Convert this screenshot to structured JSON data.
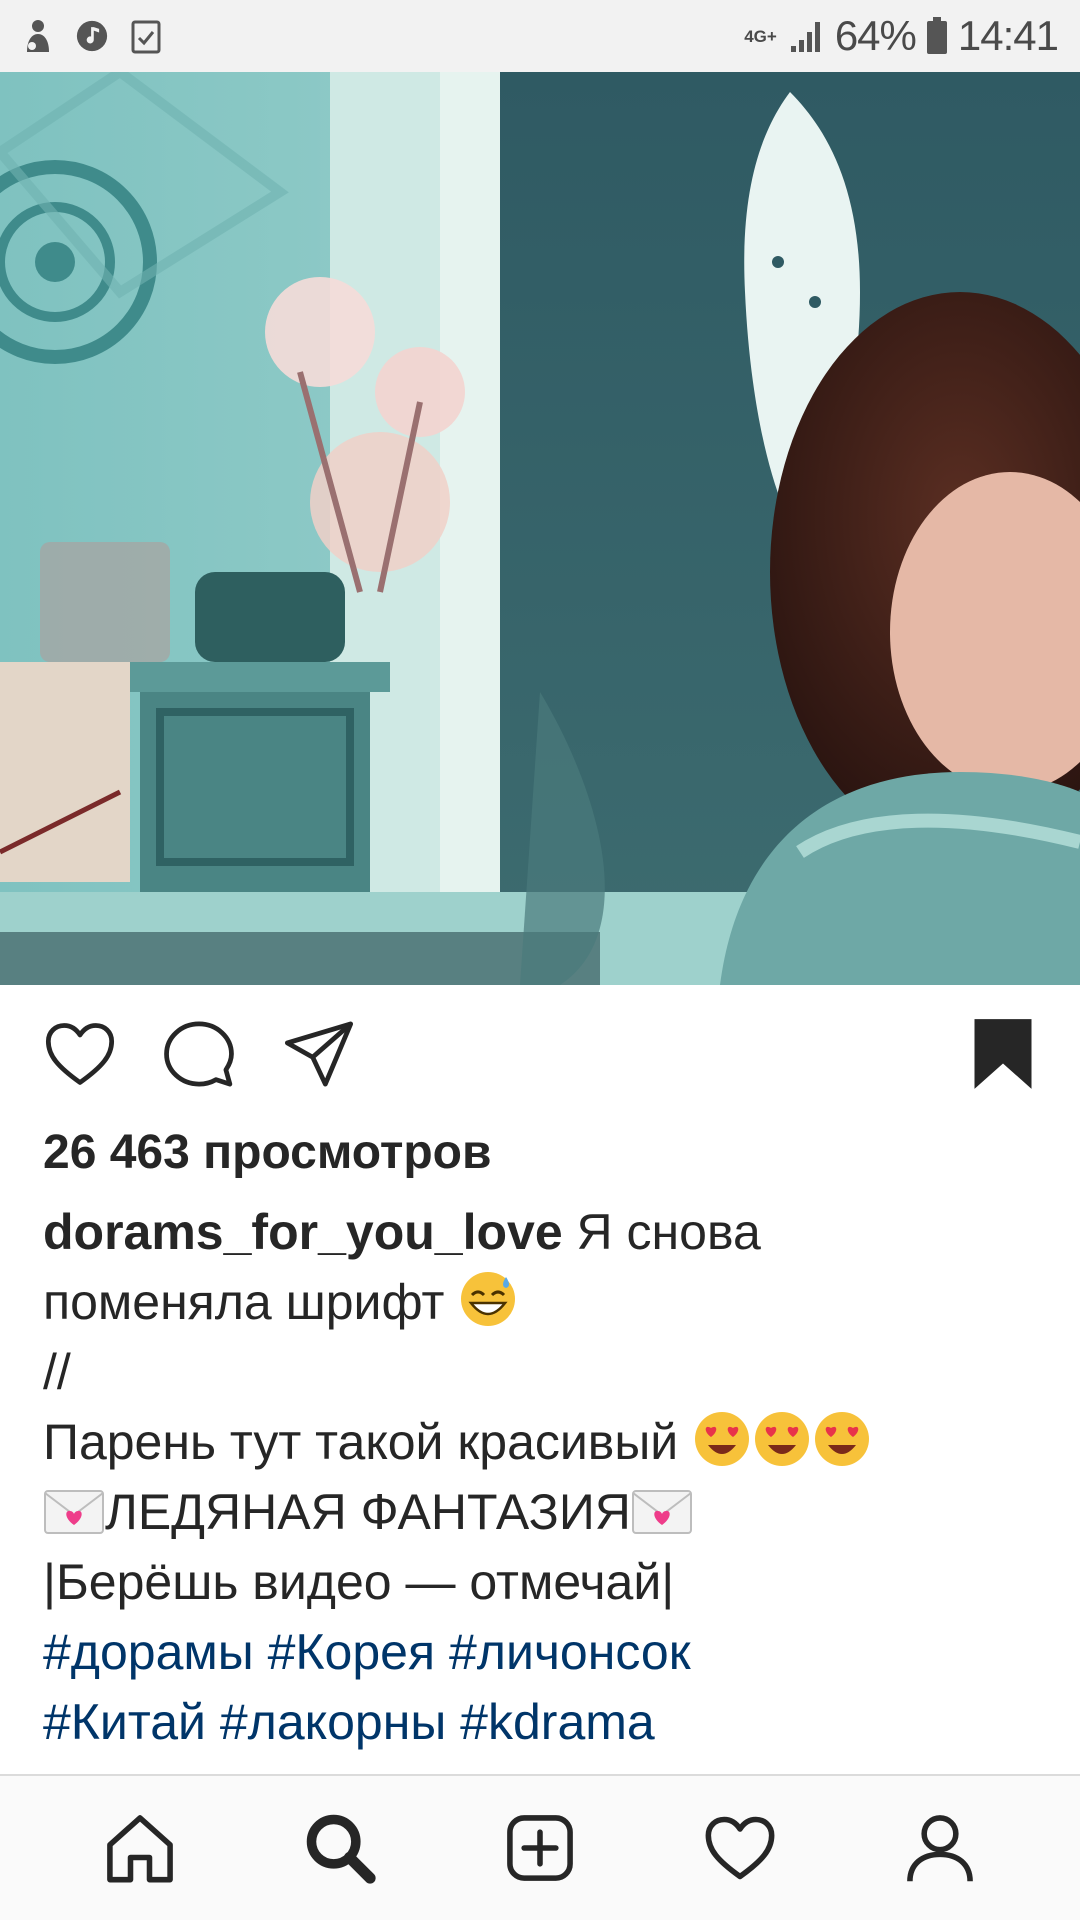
{
  "status_bar": {
    "network_type": "4G+",
    "battery": "64%",
    "time": "14:41",
    "left_icons": [
      "app-notification-icon",
      "music-note-icon",
      "clipboard-check-icon"
    ],
    "right_icons": [
      "signal-icon",
      "battery-icon"
    ]
  },
  "media": {
    "kind": "video",
    "colors": {
      "teal": "#5fa0a0",
      "dark_teal": "#2d5a5e",
      "light": "#dfe9e6"
    }
  },
  "actions": {
    "icons": [
      "heart-icon",
      "comment-icon",
      "share-icon",
      "bookmark-icon"
    ]
  },
  "post": {
    "views": "26 463 просмотров",
    "username": "dorams_for_you_love",
    "caption_first": "Я снова",
    "line2": "поменяла шрифт",
    "line3": "//",
    "line4": "Парень тут такой красивый",
    "line5": "ЛЕДЯНАЯ ФАНТАЗИЯ",
    "line6": "|Берёшь видео — отмечай|",
    "hashtags_line1": [
      "#дорамы",
      "#Корея",
      "#личонсок"
    ],
    "hashtags_line2": [
      "#Китай",
      "#лакорны",
      "#kdrama"
    ],
    "hashtag_color": "#003569"
  },
  "bottom_nav": {
    "items": [
      "home-icon",
      "search-icon",
      "add-post-icon",
      "activity-heart-icon",
      "profile-icon"
    ],
    "active": "search-icon"
  }
}
